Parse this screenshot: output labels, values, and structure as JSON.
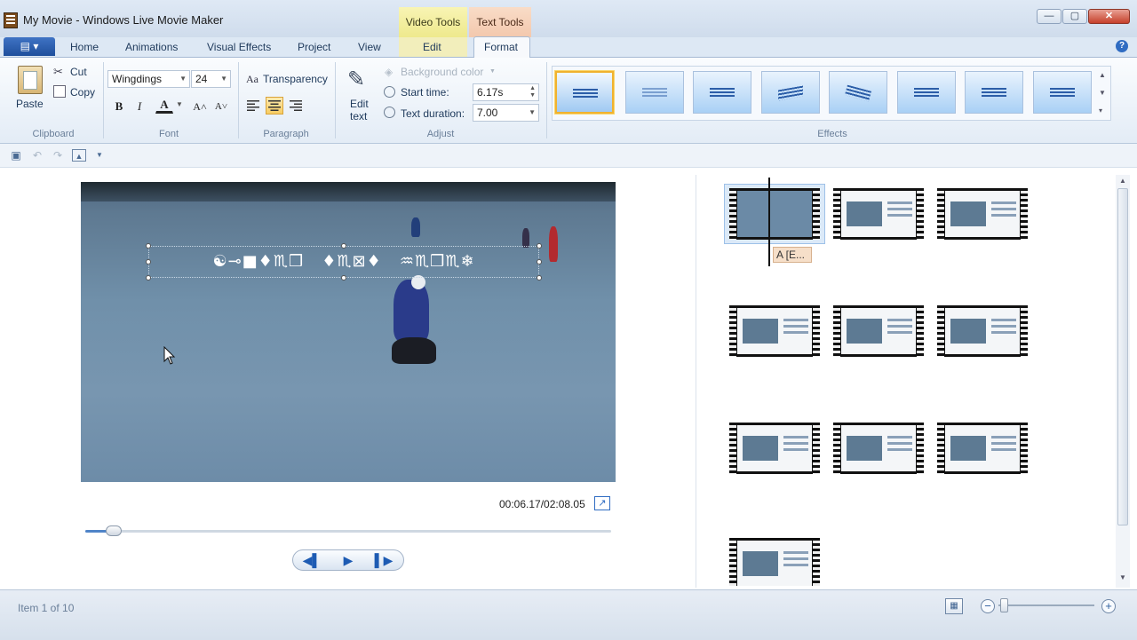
{
  "window": {
    "title": "My Movie - Windows Live Movie Maker",
    "min_label": "—",
    "max_label": "▢",
    "close_label": "✕"
  },
  "context_tabs": {
    "video_tools": "Video Tools",
    "text_tools": "Text Tools"
  },
  "tabs": {
    "file_glyph": "▤ ▾",
    "home": "Home",
    "animations": "Animations",
    "visual_effects": "Visual Effects",
    "project": "Project",
    "view": "View",
    "edit": "Edit",
    "format": "Format",
    "help_glyph": "?"
  },
  "ribbon": {
    "clipboard": {
      "paste": "Paste",
      "cut": "Cut",
      "copy": "Copy",
      "label": "Clipboard"
    },
    "font": {
      "family": "Wingdings",
      "size": "24",
      "bold": "B",
      "italic": "I",
      "color": "A",
      "grow": "A˄",
      "shrink": "A˅",
      "label": "Font"
    },
    "paragraph": {
      "transparency": "Transparency",
      "label": "Paragraph"
    },
    "adjust": {
      "edit_text_line1": "Edit",
      "edit_text_line2": "text",
      "background_color": "Background color",
      "start_time_label": "Start time:",
      "start_time_value": "6.17s",
      "text_duration_label": "Text duration:",
      "text_duration_value": "7.00",
      "label": "Adjust"
    },
    "effects": {
      "label": "Effects",
      "count": 8,
      "selected_index": 0
    }
  },
  "preview": {
    "overlay_text": "☯⊸■♦♏❒   ♦♏⊠♦   ♒♏❒♏❄",
    "timecode": "00:06.17/02:08.05",
    "seek_fraction": 0.05
  },
  "playback": {
    "prev": "◀▌",
    "play": "▶",
    "next": "▌▶"
  },
  "storyboard": {
    "caption_tag": "A [E...",
    "items": 10
  },
  "status": {
    "item_text": "Item 1 of 10",
    "zoom_out": "−",
    "zoom_in": "+"
  }
}
